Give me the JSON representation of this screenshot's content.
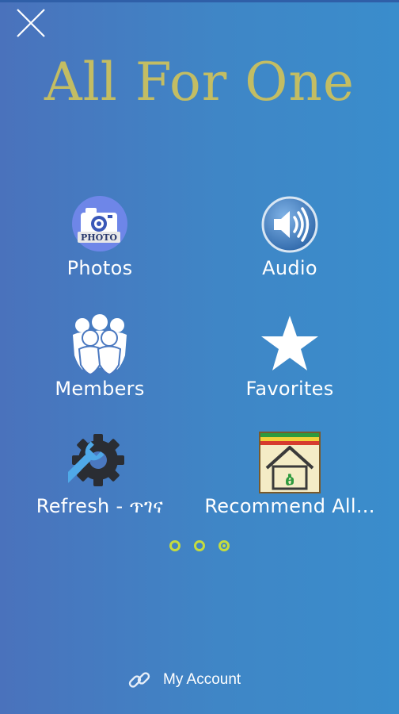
{
  "header": {
    "title": "All For One",
    "close_icon": "close-icon"
  },
  "menu": {
    "items": [
      {
        "label": "Photos",
        "icon": "photo-camera-icon"
      },
      {
        "label": "Audio",
        "icon": "speaker-icon"
      },
      {
        "label": "Members",
        "icon": "members-icon"
      },
      {
        "label": "Favorites",
        "icon": "star-icon"
      },
      {
        "label": "Refresh - ጥገና",
        "icon": "settings-wrench-icon"
      },
      {
        "label": "Recommend All...",
        "icon": "recommend-house-icon"
      }
    ]
  },
  "pagination": {
    "pages": 3,
    "current": 3
  },
  "footer": {
    "account_label": "My Account",
    "account_icon": "link-icon"
  },
  "colors": {
    "title": "#c3bd63",
    "dots": "#c5dc3e",
    "background_start": "#4a72bc",
    "background_end": "#3a8dcc"
  }
}
